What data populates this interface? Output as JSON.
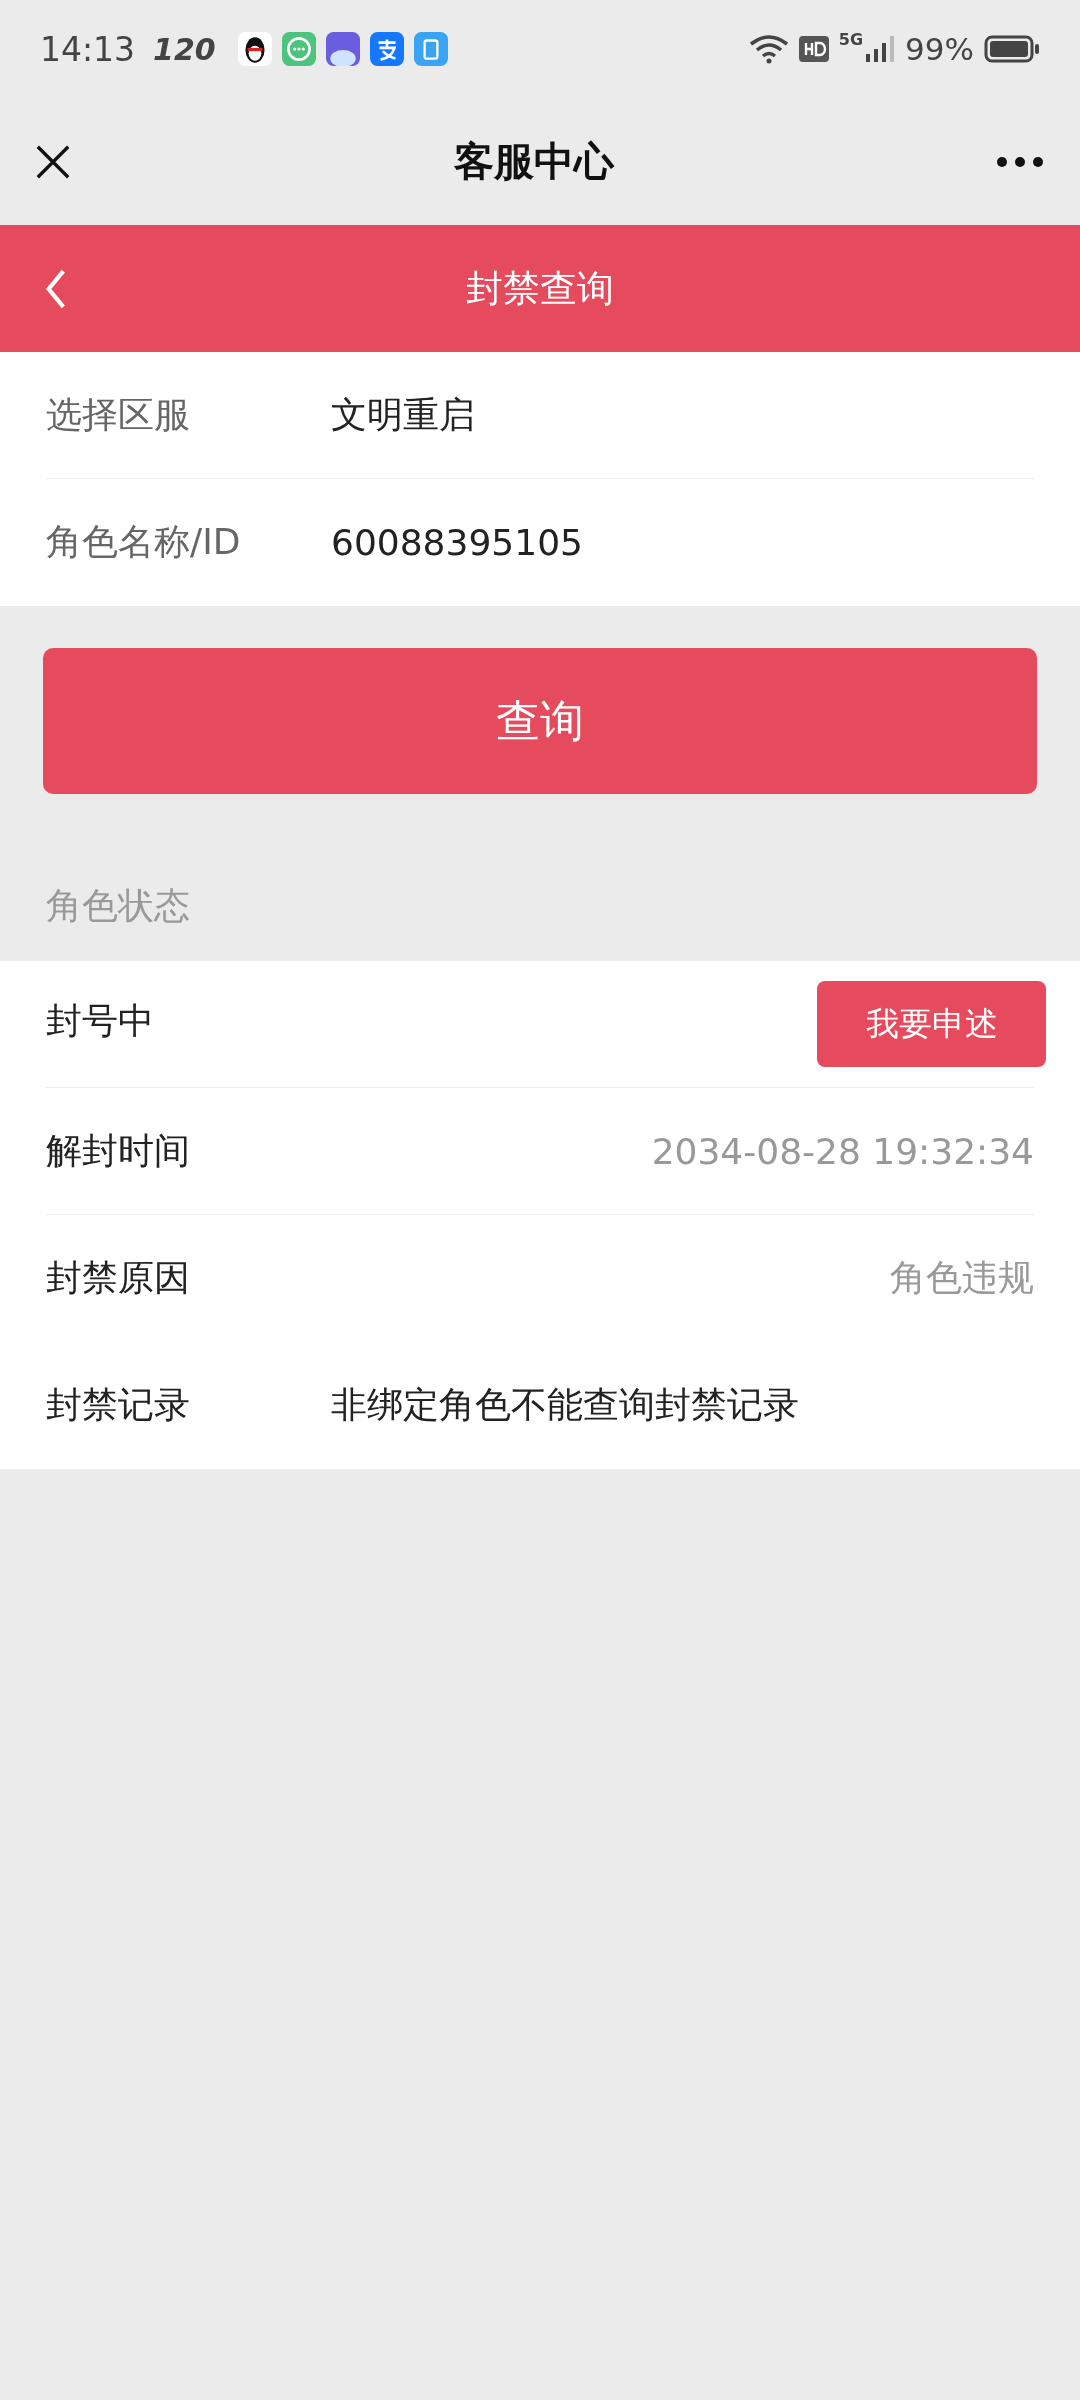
{
  "status_bar": {
    "time": "14:13",
    "refresh_rate": "120",
    "battery": "99%",
    "network": "5G"
  },
  "nav": {
    "title": "客服中心"
  },
  "page_header": {
    "title": "封禁查询"
  },
  "form": [
    {
      "label": "选择区服",
      "value": "文明重启"
    },
    {
      "label": "角色名称/ID",
      "value": "60088395105"
    }
  ],
  "query_button": "查询",
  "section_title": "角色状态",
  "status_rows": [
    {
      "kind": "action",
      "label": "封号中",
      "button": "我要申述"
    },
    {
      "kind": "right",
      "label": "解封时间",
      "value": "2034-08-28 19:32:34"
    },
    {
      "kind": "right",
      "label": "封禁原因",
      "value": "角色违规"
    },
    {
      "kind": "left",
      "label": "封禁记录",
      "value": "非绑定角色不能查询封禁记录"
    }
  ]
}
